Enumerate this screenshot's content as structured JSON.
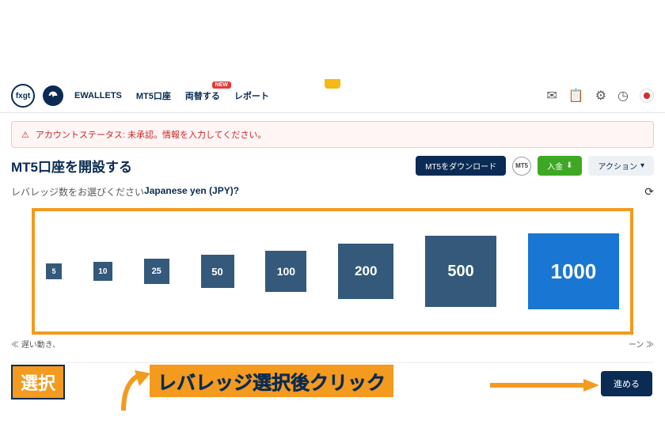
{
  "header": {
    "logo": "fxgt",
    "nav": {
      "ewallets": "EWALLETS",
      "mt5": "MT5口座",
      "exchange": "両替する",
      "report": "レポート",
      "badge_new": "NEW"
    }
  },
  "alert": {
    "text": "アカウントステータス: 未承認。情報を入力してください。"
  },
  "title": "MT5口座を開設する",
  "actions": {
    "download": "MT5をダウンロード",
    "mt5_badge": "MT5",
    "deposit": "入金",
    "action": "アクション"
  },
  "prompt": {
    "label": "レバレッジ数をお選びください",
    "currency": "Japanese yen (JPY)?"
  },
  "leverage": [
    "5",
    "10",
    "25",
    "50",
    "100",
    "200",
    "500",
    "1000"
  ],
  "pager": {
    "prev": "≪ 遅い動き、",
    "next": "ーン ≫"
  },
  "annotations": {
    "select": "選択",
    "main": "レバレッジ選択後クリック"
  },
  "proceed": "進める"
}
